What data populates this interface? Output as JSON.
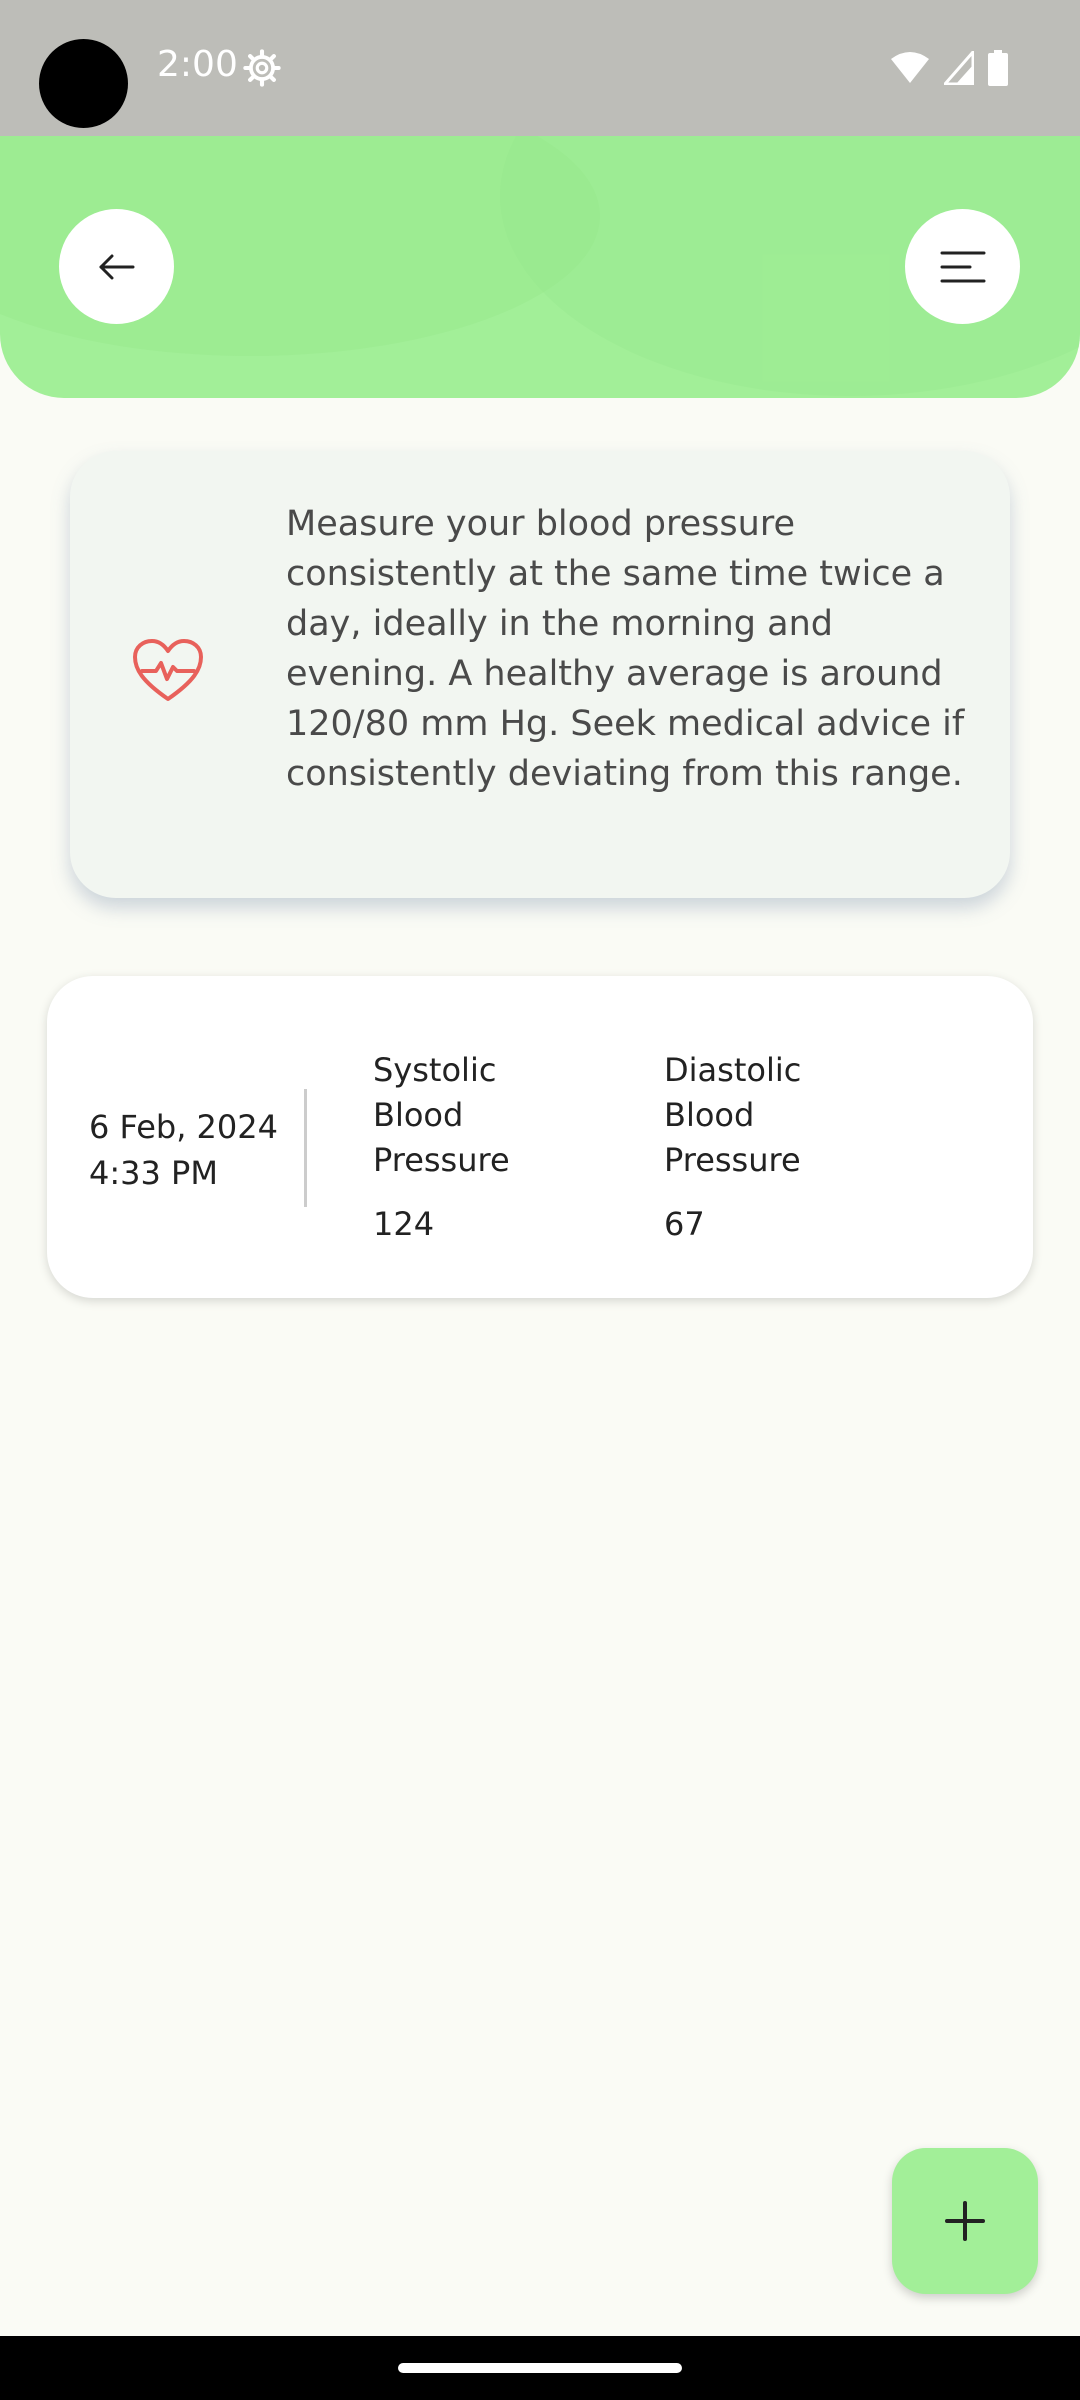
{
  "status_bar": {
    "time": "2:00",
    "icons": [
      "settings-gear-icon",
      "wifi-icon",
      "cellular-signal-icon",
      "battery-icon"
    ]
  },
  "header": {
    "back_icon": "arrow-left-icon",
    "menu_icon": "menu-lines-icon",
    "color": "#a2ef98"
  },
  "info_card": {
    "icon": "heart-pulse-icon",
    "text": "Measure your blood pressure consistently at the same time twice a day, ideally in the morning and evening. A healthy average is around 120/80 mm Hg. Seek medical advice if consistently deviating from this range."
  },
  "records": [
    {
      "date": "6 Feb, 2024",
      "time": "4:33 PM",
      "systolic_label": "Systolic Blood Pressure",
      "systolic_value": "124",
      "diastolic_label": "Diastolic Blood Pressure",
      "diastolic_value": "67"
    }
  ],
  "fab": {
    "icon": "plus-icon"
  },
  "colors": {
    "accent": "#a2ef98",
    "heart": "#e8615b",
    "background": "#fafbf5"
  }
}
